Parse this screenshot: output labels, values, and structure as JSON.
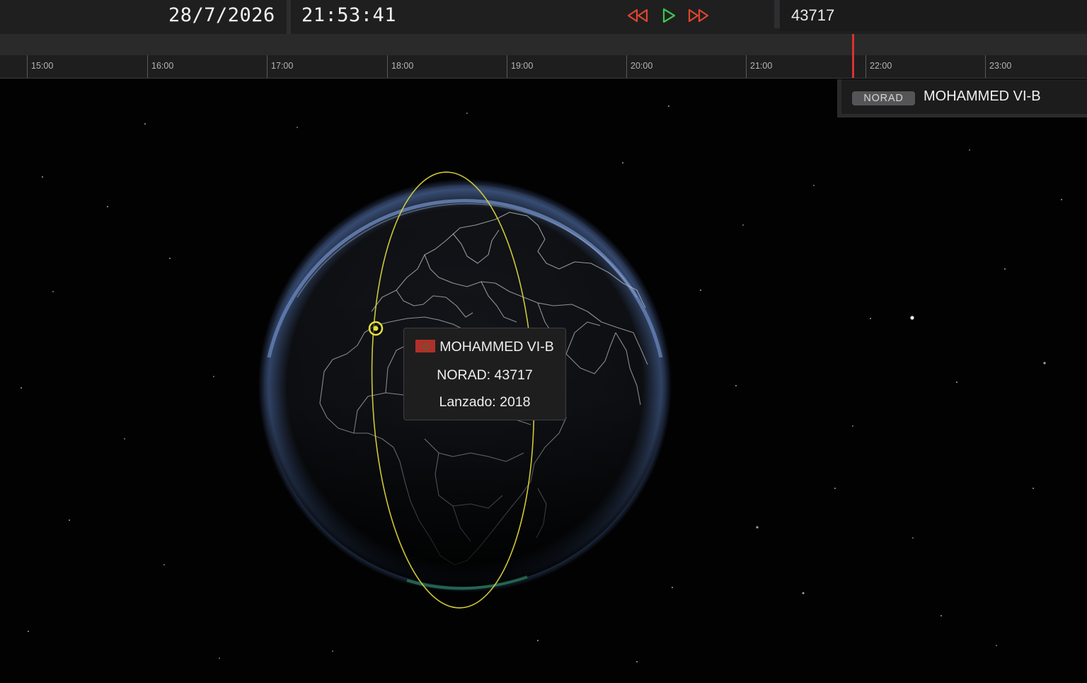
{
  "header": {
    "date": "28/7/2026",
    "time": "21:53:41",
    "controls": {
      "rewind_icon": "rewind-icon",
      "play_icon": "play-icon",
      "fast_forward_icon": "fast-forward-icon",
      "rewind_color": "#e0452d",
      "play_color": "#3ec64a",
      "fast_forward_color": "#e0452d"
    },
    "search_value": "43717"
  },
  "timeline": {
    "ticks": [
      "15:00",
      "16:00",
      "17:00",
      "18:00",
      "19:00",
      "20:00",
      "21:00",
      "22:00",
      "23:00"
    ],
    "now_marker_color": "#d9332c"
  },
  "satellite_list": {
    "items": [
      {
        "badge": "NORAD",
        "name": "MOHAMMED VI-B"
      }
    ]
  },
  "popup": {
    "name": "MOHAMMED VI-B",
    "norad_line": "NORAD: 43717",
    "launch_line": "Lanzado: 2018",
    "flag": "morocco-flag"
  },
  "scene": {
    "orbit_color": "#d9d23a",
    "satellite_marker_color": "#e6e040",
    "globe_glow_color": "#5a7fc4"
  }
}
